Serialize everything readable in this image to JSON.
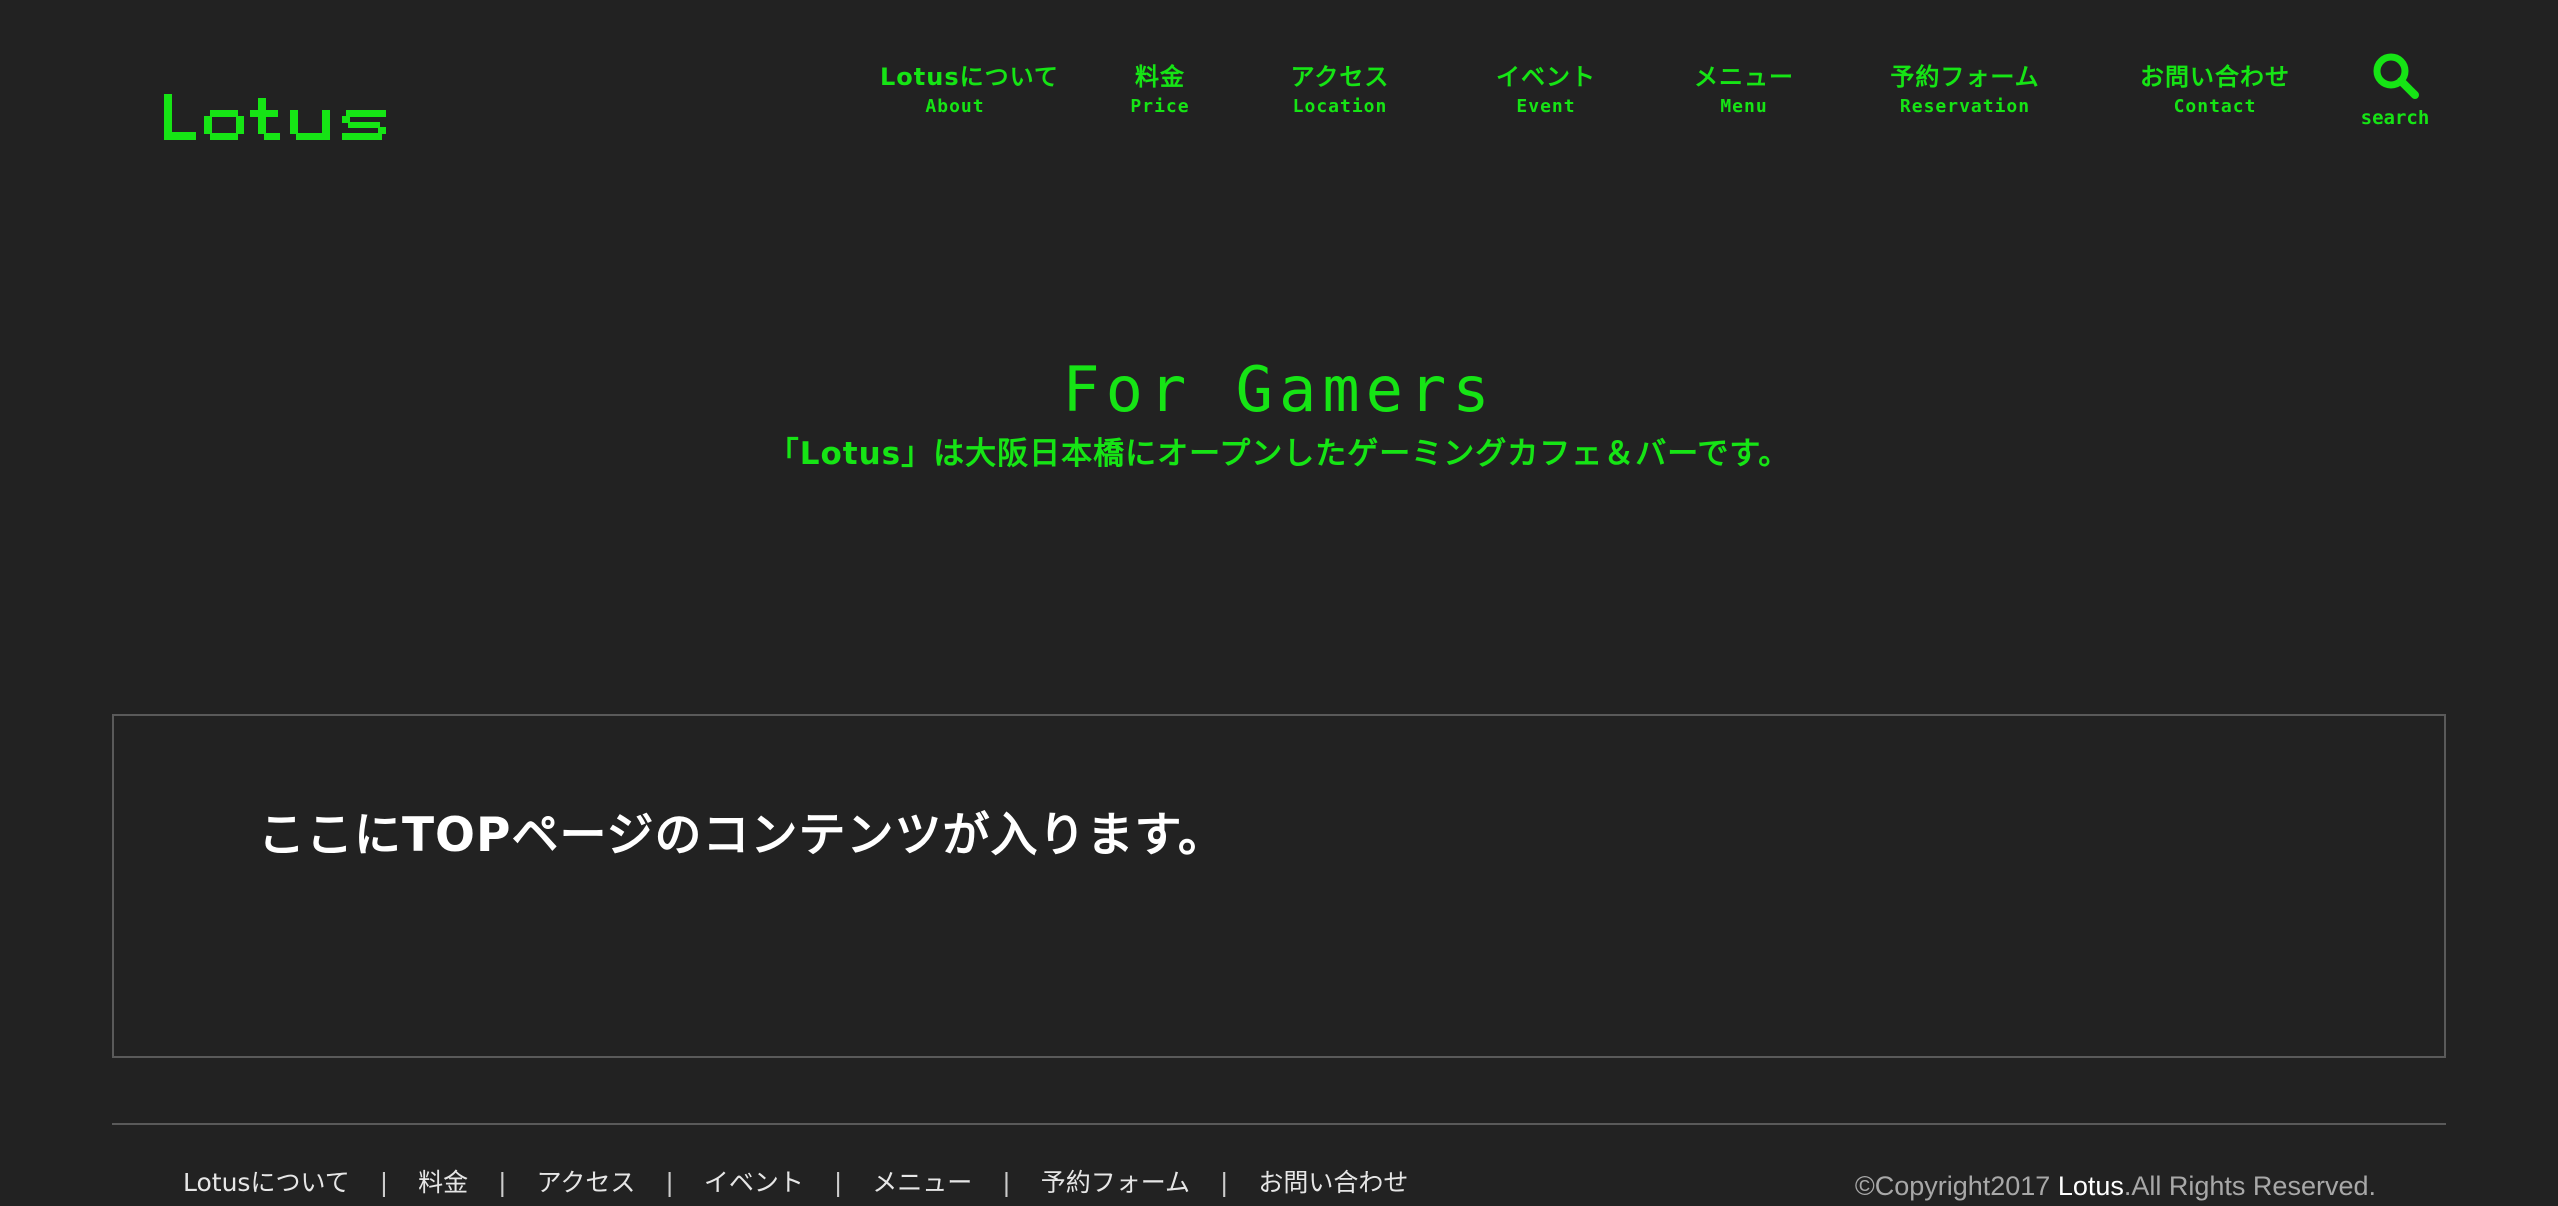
{
  "header": {
    "logo_text": "Lotus",
    "nav": [
      {
        "ja": "Lotusについて",
        "en": "About"
      },
      {
        "ja": "料金",
        "en": "Price"
      },
      {
        "ja": "アクセス",
        "en": "Location"
      },
      {
        "ja": "イベント",
        "en": "Event"
      },
      {
        "ja": "メニュー",
        "en": "Menu"
      },
      {
        "ja": "予約フォーム",
        "en": "Reservation"
      },
      {
        "ja": "お問い合わせ",
        "en": "Contact"
      }
    ],
    "search": {
      "label": "search",
      "icon": "search-icon"
    }
  },
  "hero": {
    "title": "For Gamers",
    "subtitle": "「Lotus」は大阪日本橋にオープンしたゲーミングカフェ＆バーです。"
  },
  "content": {
    "text": "ここにTOPページのコンテンツが入ります。"
  },
  "footer": {
    "links": [
      "Lotusについて",
      "料金",
      "アクセス",
      "イベント",
      "メニュー",
      "予約フォーム",
      "お問い合わせ"
    ],
    "separator": "|",
    "copyright_prefix": "©Copyright2017 ",
    "copyright_brand": "Lotus",
    "copyright_suffix": ".All Rights Reserved."
  },
  "colors": {
    "background": "#222222",
    "accent": "#16e415",
    "border": "#5a5a5a"
  }
}
